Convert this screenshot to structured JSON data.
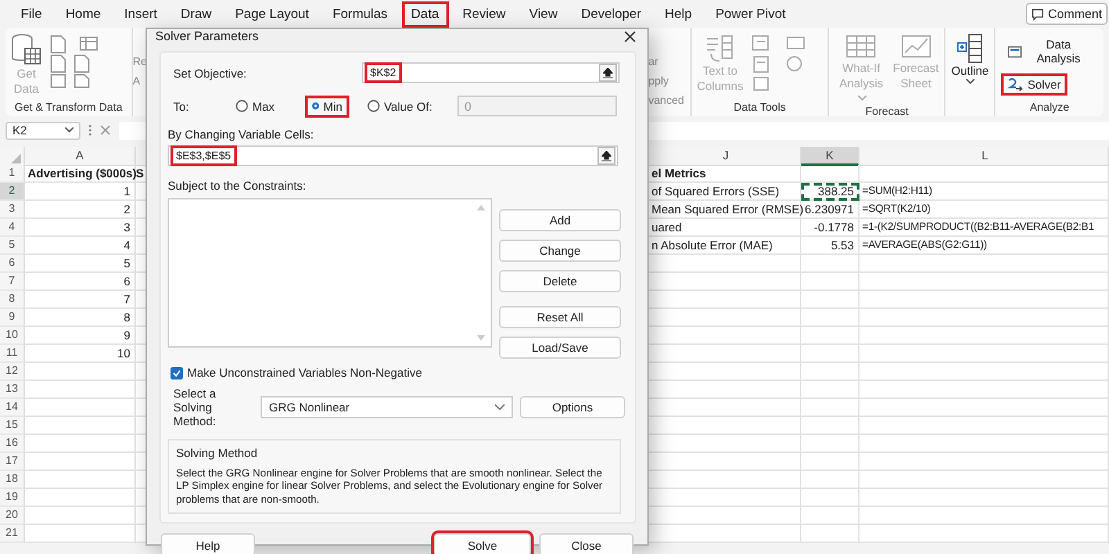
{
  "menu_tabs": [
    {
      "label": "File",
      "selected": false,
      "highlighted": false
    },
    {
      "label": "Home",
      "selected": false,
      "highlighted": false
    },
    {
      "label": "Insert",
      "selected": false,
      "highlighted": false
    },
    {
      "label": "Draw",
      "selected": false,
      "highlighted": false
    },
    {
      "label": "Page Layout",
      "selected": false,
      "highlighted": false
    },
    {
      "label": "Formulas",
      "selected": false,
      "highlighted": false
    },
    {
      "label": "Data",
      "selected": true,
      "highlighted": true
    },
    {
      "label": "Review",
      "selected": false,
      "highlighted": false
    },
    {
      "label": "View",
      "selected": false,
      "highlighted": false
    },
    {
      "label": "Developer",
      "selected": false,
      "highlighted": false
    },
    {
      "label": "Help",
      "selected": false,
      "highlighted": false
    },
    {
      "label": "Power Pivot",
      "selected": false,
      "highlighted": false
    }
  ],
  "comments_button": "Comment",
  "ribbon": {
    "get_data": {
      "lines": [
        "Get",
        "Data"
      ],
      "disabled": true
    },
    "get_transform_label": "Get & Transform Data",
    "refresh_fragment": [
      "Re",
      "A"
    ],
    "sort_filter_fragments": [
      "ar",
      "pply",
      "vanced"
    ],
    "data_tools": {
      "button": [
        "Text to",
        "Columns"
      ],
      "disabled": true,
      "label": "Data Tools"
    },
    "forecast": {
      "buttons": [
        {
          "lines": [
            "What-If",
            "Analysis"
          ],
          "dropdown": true,
          "disabled": true
        },
        {
          "lines": [
            "Forecast",
            "Sheet"
          ],
          "dropdown": false,
          "disabled": true
        }
      ],
      "label": "Forecast"
    },
    "outline": {
      "label": "Outline"
    },
    "analyze": {
      "items": [
        {
          "label": "Data Analysis",
          "highlighted": false
        },
        {
          "label": "Solver",
          "highlighted": true
        }
      ],
      "label": "Analyze"
    }
  },
  "name_box": "K2",
  "sheet": {
    "columns": [
      {
        "label": "A",
        "selected": false
      },
      {
        "label": "J",
        "selected": false
      },
      {
        "label": "K",
        "selected": true
      },
      {
        "label": "L",
        "selected": false
      }
    ],
    "rows": [
      {
        "number": "1",
        "selected": false,
        "bold": true,
        "a": "Advertising ($000s)",
        "b": "S",
        "j": "el Metrics"
      },
      {
        "number": "2",
        "selected": true,
        "bold": false,
        "a": "1",
        "j": "of Squared Errors (SSE)",
        "k": "388.25",
        "l": "=SUM(H2:H11)"
      },
      {
        "number": "3",
        "selected": false,
        "bold": false,
        "a": "2",
        "j": "Mean Squared Error (RMSE)",
        "k": "6.230971",
        "l": "=SQRT(K2/10)"
      },
      {
        "number": "4",
        "selected": false,
        "bold": false,
        "a": "3",
        "j": "uared",
        "k": "-0.1778",
        "l": "=1-(K2/SUMPRODUCT((B2:B11-AVERAGE(B2:B1"
      },
      {
        "number": "5",
        "selected": false,
        "bold": false,
        "a": "4",
        "j": "n Absolute Error (MAE)",
        "k": "5.53",
        "l": "=AVERAGE(ABS(G2:G11))"
      },
      {
        "number": "6",
        "selected": false,
        "bold": false,
        "a": "5"
      },
      {
        "number": "7",
        "selected": false,
        "bold": false,
        "a": "6"
      },
      {
        "number": "8",
        "selected": false,
        "bold": false,
        "a": "7"
      },
      {
        "number": "9",
        "selected": false,
        "bold": false,
        "a": "8"
      },
      {
        "number": "10",
        "selected": false,
        "bold": false,
        "a": "9"
      },
      {
        "number": "11",
        "selected": false,
        "bold": false,
        "a": "10"
      },
      {
        "number": "12",
        "selected": false,
        "bold": false
      },
      {
        "number": "13",
        "selected": false,
        "bold": false
      },
      {
        "number": "14",
        "selected": false,
        "bold": false
      },
      {
        "number": "15",
        "selected": false,
        "bold": false
      },
      {
        "number": "16",
        "selected": false,
        "bold": false
      },
      {
        "number": "17",
        "selected": false,
        "bold": false
      },
      {
        "number": "18",
        "selected": false,
        "bold": false
      },
      {
        "number": "19",
        "selected": false,
        "bold": false
      },
      {
        "number": "20",
        "selected": false,
        "bold": false
      },
      {
        "number": "21",
        "selected": false,
        "bold": false
      }
    ]
  },
  "dialog": {
    "title": "Solver Parameters",
    "objective": {
      "label": "Set Objective:",
      "value": "$K$2",
      "highlighted": true
    },
    "to": {
      "label": "To:",
      "options": [
        {
          "label": "Max",
          "selected": false,
          "highlighted": false
        },
        {
          "label": "Min",
          "selected": true,
          "highlighted": true
        },
        {
          "label": "Value Of:",
          "selected": false,
          "highlighted": false
        }
      ],
      "value_field": "0"
    },
    "changing_cells": {
      "label": "By Changing Variable Cells:",
      "value": "$E$3,$E$5",
      "highlighted": true
    },
    "constraints": {
      "label": "Subject to the Constraints:",
      "buttons": [
        "Add",
        "Change",
        "Delete",
        "Reset All",
        "Load/Save"
      ]
    },
    "non_negative": {
      "label": "Make Unconstrained Variables Non-Negative",
      "checked": true
    },
    "method": {
      "label": "Select a Solving Method:",
      "value": "GRG Nonlinear",
      "options_button": "Options"
    },
    "description": {
      "title": "Solving Method",
      "text": "Select the GRG Nonlinear engine for Solver Problems that are smooth nonlinear. Select the LP Simplex engine for linear Solver Problems, and select the Evolutionary engine for Solver problems that are non-smooth."
    },
    "footer_buttons": [
      {
        "label": "Help",
        "highlighted": false
      },
      {
        "label": "Solve",
        "highlighted": true
      },
      {
        "label": "Close",
        "highlighted": false
      }
    ]
  }
}
